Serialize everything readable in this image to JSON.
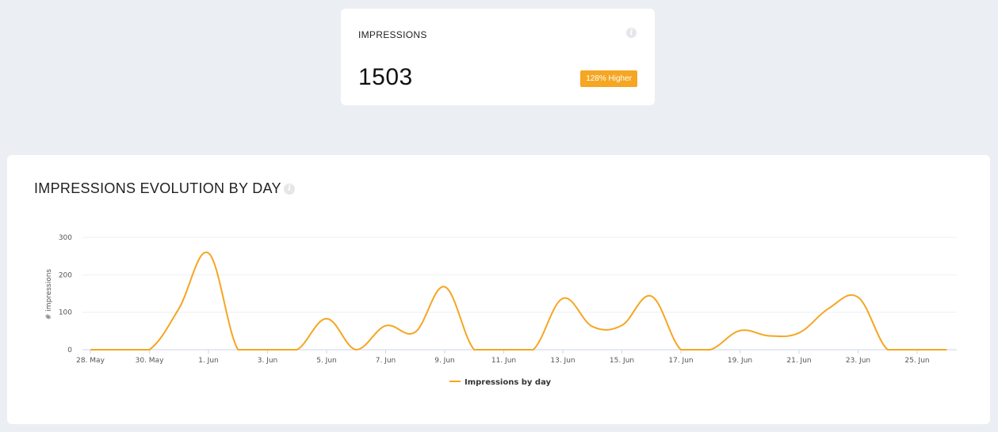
{
  "kpi": {
    "title": "IMPRESSIONS",
    "value": "1503",
    "badge": "128% Higher",
    "info_icon": "info-icon"
  },
  "chart_section": {
    "title": "IMPRESSIONS EVOLUTION BY DAY",
    "info_icon": "info-icon"
  },
  "colors": {
    "accent": "#f5a623",
    "background": "#ebeef3",
    "card": "#ffffff"
  },
  "chart_data": {
    "type": "line",
    "title": "",
    "xlabel": "",
    "ylabel": "# impressions",
    "ylim": [
      0,
      300
    ],
    "y_ticks": [
      "0",
      "100",
      "200",
      "300"
    ],
    "x_ticks": [
      "28. May",
      "30. May",
      "1. Jun",
      "3. Jun",
      "5. Jun",
      "7. Jun",
      "9. Jun",
      "11. Jun",
      "13. Jun",
      "15. Jun",
      "17. Jun",
      "19. Jun",
      "21. Jun",
      "23. Jun",
      "25. Jun"
    ],
    "x": [
      "28. May",
      "29. May",
      "30. May",
      "31. May",
      "1. Jun",
      "2. Jun",
      "3. Jun",
      "4. Jun",
      "5. Jun",
      "6. Jun",
      "7. Jun",
      "8. Jun",
      "9. Jun",
      "10. Jun",
      "11. Jun",
      "12. Jun",
      "13. Jun",
      "14. Jun",
      "15. Jun",
      "16. Jun",
      "17. Jun",
      "18. Jun",
      "19. Jun",
      "20. Jun",
      "21. Jun",
      "22. Jun",
      "23. Jun",
      "24. Jun",
      "25. Jun",
      "26. Jun"
    ],
    "series": [
      {
        "name": "Impressions by day",
        "values": [
          0,
          0,
          0,
          110,
          258,
          0,
          0,
          0,
          83,
          0,
          64,
          47,
          168,
          0,
          0,
          0,
          137,
          62,
          65,
          143,
          0,
          0,
          51,
          37,
          45,
          110,
          140,
          0,
          0,
          0
        ]
      }
    ],
    "grid": true,
    "legend": "bottom-center"
  }
}
